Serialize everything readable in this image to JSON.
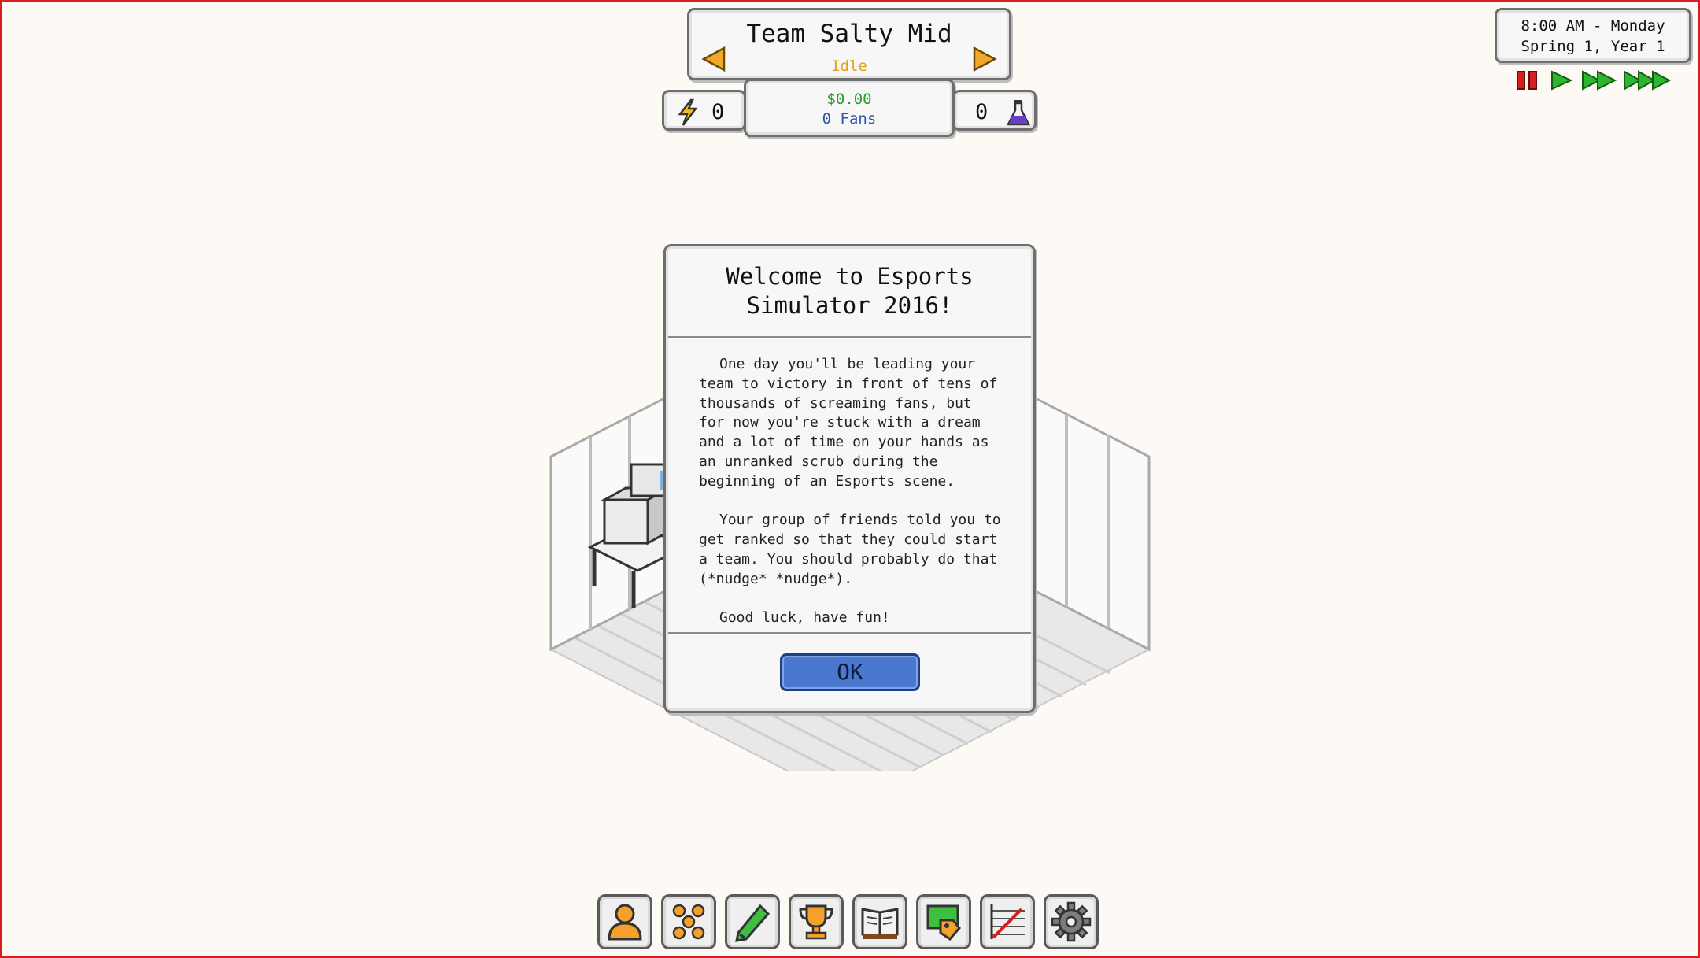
{
  "team": {
    "name": "Team Salty Mid",
    "status": "Idle"
  },
  "stats": {
    "energy": "0",
    "money": "$0.00",
    "fans": "0 Fans",
    "research": "0"
  },
  "clock": {
    "time": "8:00 AM - Monday",
    "date": "Spring 1, Year 1"
  },
  "speed_controls": [
    "pause-icon",
    "play-icon",
    "fast-forward-icon",
    "fastest-forward-icon"
  ],
  "dialog": {
    "title": "Welcome to Esports Simulator 2016!",
    "paragraphs": [
      "One day you'll be leading your team to victory in front of tens of thousands of screaming fans, but for now you're stuck with a dream and a lot of time on your hands as an unranked scrub during the beginning of an Esports scene.",
      "Your group of friends told you to get ranked so that they could start a team. You should probably do that (*nudge* *nudge*).",
      "Good luck, have fun!"
    ],
    "ok_label": "OK"
  },
  "toolbar": [
    "player-icon",
    "team-icon",
    "pencil-icon",
    "trophy-icon",
    "book-icon",
    "shop-tag-icon",
    "stats-chart-icon",
    "gear-icon"
  ],
  "colors": {
    "status": "#e0a21a",
    "money": "#2a9a2a",
    "fans": "#2f55b5",
    "ok_button": "#4a78cf",
    "speed_active": "#2fb52f",
    "pause": "#d62020"
  }
}
